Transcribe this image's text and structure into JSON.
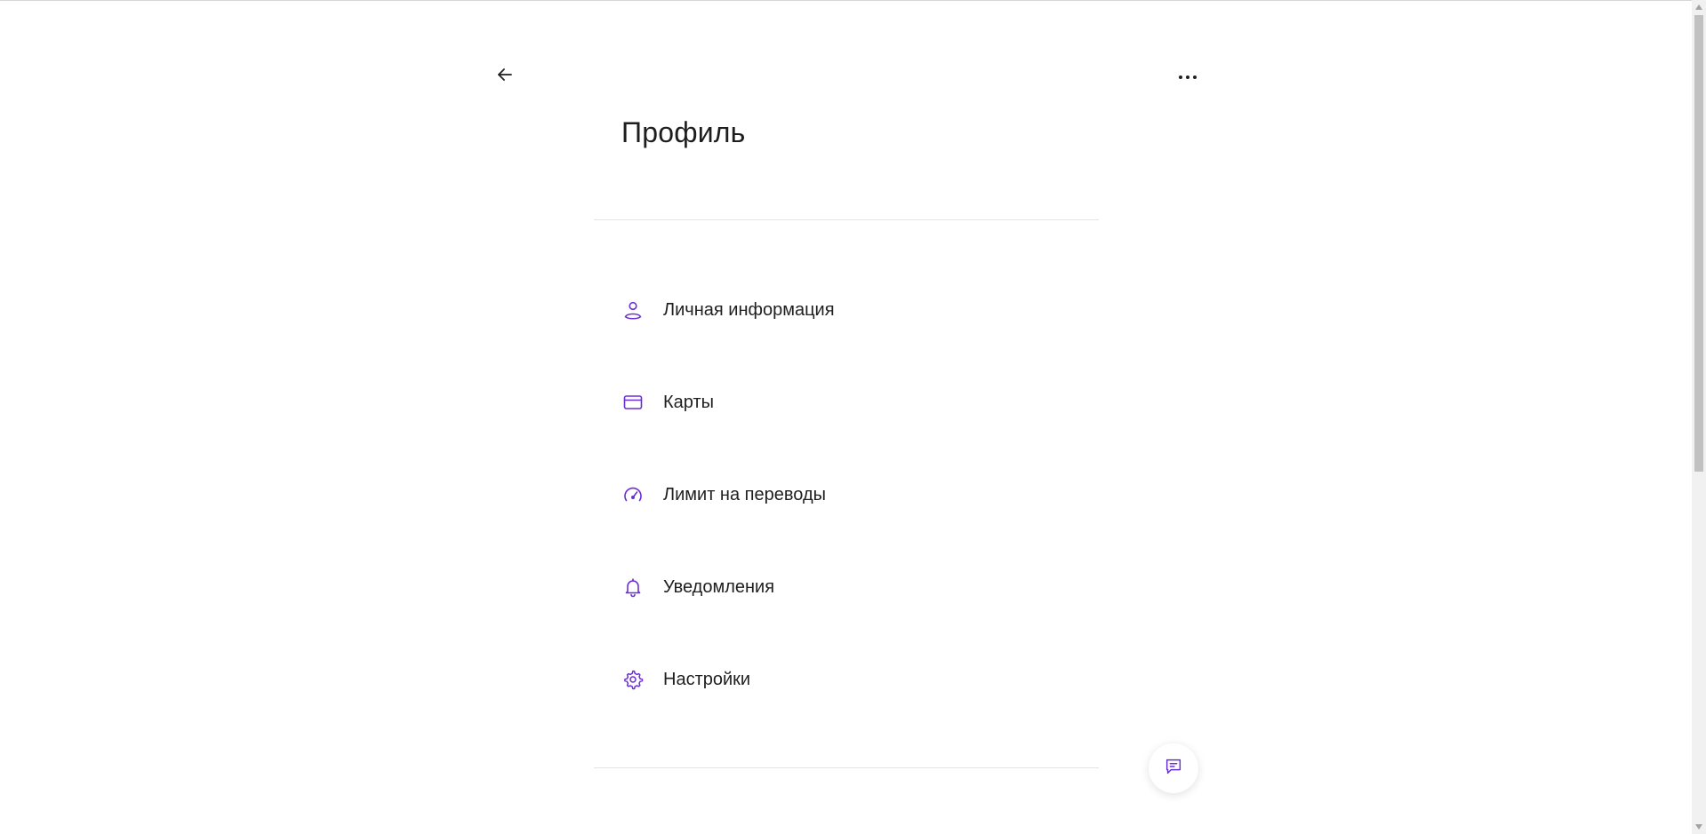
{
  "header": {
    "back_icon": "arrow-left-icon",
    "more_icon": "more-horizontal-icon",
    "title": "Профиль"
  },
  "menu": {
    "items": [
      {
        "label": "Личная информация",
        "icon": "user-icon"
      },
      {
        "label": "Карты",
        "icon": "card-icon"
      },
      {
        "label": "Лимит на переводы",
        "icon": "speedometer-icon"
      },
      {
        "label": "Уведомления",
        "icon": "bell-icon"
      },
      {
        "label": "Настройки",
        "icon": "gear-icon"
      }
    ]
  },
  "chat": {
    "icon": "chat-icon"
  },
  "colors": {
    "accent": "#6b2fd6",
    "text": "#1f1f1f",
    "divider": "#e4e4e4"
  }
}
